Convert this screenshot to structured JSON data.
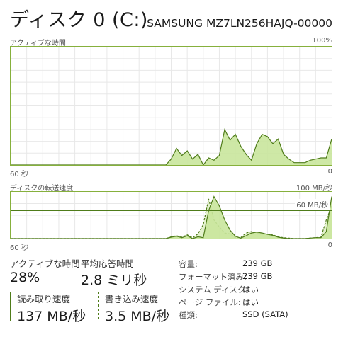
{
  "header": {
    "title": "ディスク 0 (C:)",
    "model": "SAMSUNG MZ7LN256HAJQ-00000"
  },
  "active_time_chart": {
    "label": "アクティブな時間",
    "max_label": "100%",
    "time_left": "60 秒",
    "time_right": "0"
  },
  "transfer_chart": {
    "label": "ディスクの転送速度",
    "max_label": "100 MB/秒",
    "ref_line_label": "60 MB/秒",
    "time_left": "60 秒",
    "time_right": "0"
  },
  "stats": {
    "active_time_label": "アクティブな時間",
    "active_time_value": "28%",
    "avg_response_label": "平均応答時間",
    "avg_response_value": "2.8 ミリ秒",
    "read_label": "読み取り速度",
    "read_value": "137 MB/秒",
    "write_label": "書き込み速度",
    "write_value": "3.5 MB/秒"
  },
  "info": {
    "capacity_label": "容量:",
    "capacity_value": "239 GB",
    "formatted_label": "フォーマット済み:",
    "formatted_value": "239 GB",
    "system_disk_label": "システム ディスク:",
    "system_disk_value": "はい",
    "page_file_label": "ページ ファイル:",
    "page_file_value": "はい",
    "type_label": "種類:",
    "type_value": "SSD (SATA)"
  },
  "colors": {
    "accent": "#86b03c",
    "fill": "#c9e69c",
    "line": "#4f7c1a",
    "grid": "#e8e8e8"
  },
  "chart_data": [
    {
      "type": "area",
      "title": "アクティブな時間",
      "xlabel": "秒",
      "ylabel": "%",
      "xlim": [
        60,
        0
      ],
      "ylim": [
        0,
        100
      ],
      "series": [
        {
          "x": [
            60,
            58,
            56,
            54,
            52,
            50,
            48,
            46,
            44,
            42,
            40,
            38,
            36,
            34,
            32,
            31,
            30,
            29,
            28,
            27,
            26,
            25,
            24,
            23,
            22,
            21,
            20,
            19,
            18,
            17,
            16,
            15,
            14,
            13,
            12,
            11,
            10,
            9,
            8,
            7,
            6,
            5,
            4,
            3,
            2,
            1,
            0
          ],
          "values": [
            0,
            0,
            0,
            0,
            0,
            0,
            0,
            0,
            0,
            0,
            0,
            0,
            0,
            0,
            0,
            0,
            5,
            14,
            8,
            12,
            5,
            9,
            0,
            6,
            4,
            8,
            30,
            21,
            26,
            16,
            9,
            4,
            18,
            26,
            24,
            18,
            22,
            9,
            5,
            2,
            2,
            2,
            4,
            5,
            6,
            6,
            22
          ]
        }
      ]
    },
    {
      "type": "area",
      "title": "ディスクの転送速度",
      "xlabel": "秒",
      "ylabel": "MB/秒",
      "xlim": [
        60,
        0
      ],
      "ylim": [
        0,
        100
      ],
      "series": [
        {
          "name": "読み取り速度",
          "x": [
            60,
            50,
            40,
            32,
            31,
            30,
            29,
            28,
            27,
            26,
            25,
            24,
            23,
            22,
            21,
            20,
            19,
            18,
            17,
            16,
            15,
            14,
            13,
            12,
            11,
            10,
            9,
            8,
            7,
            6,
            5,
            4,
            3,
            2,
            1,
            0
          ],
          "values": [
            0,
            0,
            0,
            0,
            0,
            3,
            5,
            2,
            6,
            0,
            4,
            2,
            60,
            90,
            70,
            40,
            18,
            5,
            1,
            6,
            12,
            14,
            12,
            9,
            7,
            3,
            1,
            0,
            0,
            0,
            0,
            1,
            2,
            2,
            15,
            90
          ]
        },
        {
          "name": "書き込み速度",
          "x": [
            60,
            50,
            40,
            32,
            31,
            30,
            29,
            28,
            27,
            26,
            25,
            24,
            23,
            22,
            21,
            20,
            19,
            18,
            17,
            16,
            15,
            14,
            13,
            12,
            11,
            10,
            9,
            8,
            7,
            6,
            5,
            4,
            3,
            2,
            1,
            0
          ],
          "values": [
            0,
            0,
            0,
            0,
            0,
            4,
            6,
            3,
            8,
            2,
            10,
            30,
            85,
            40,
            25,
            12,
            10,
            2,
            2,
            12,
            15,
            12,
            10,
            9,
            8,
            4,
            2,
            1,
            0,
            0,
            0,
            1,
            2,
            3,
            40,
            70
          ]
        }
      ],
      "reference_line": 60
    }
  ]
}
